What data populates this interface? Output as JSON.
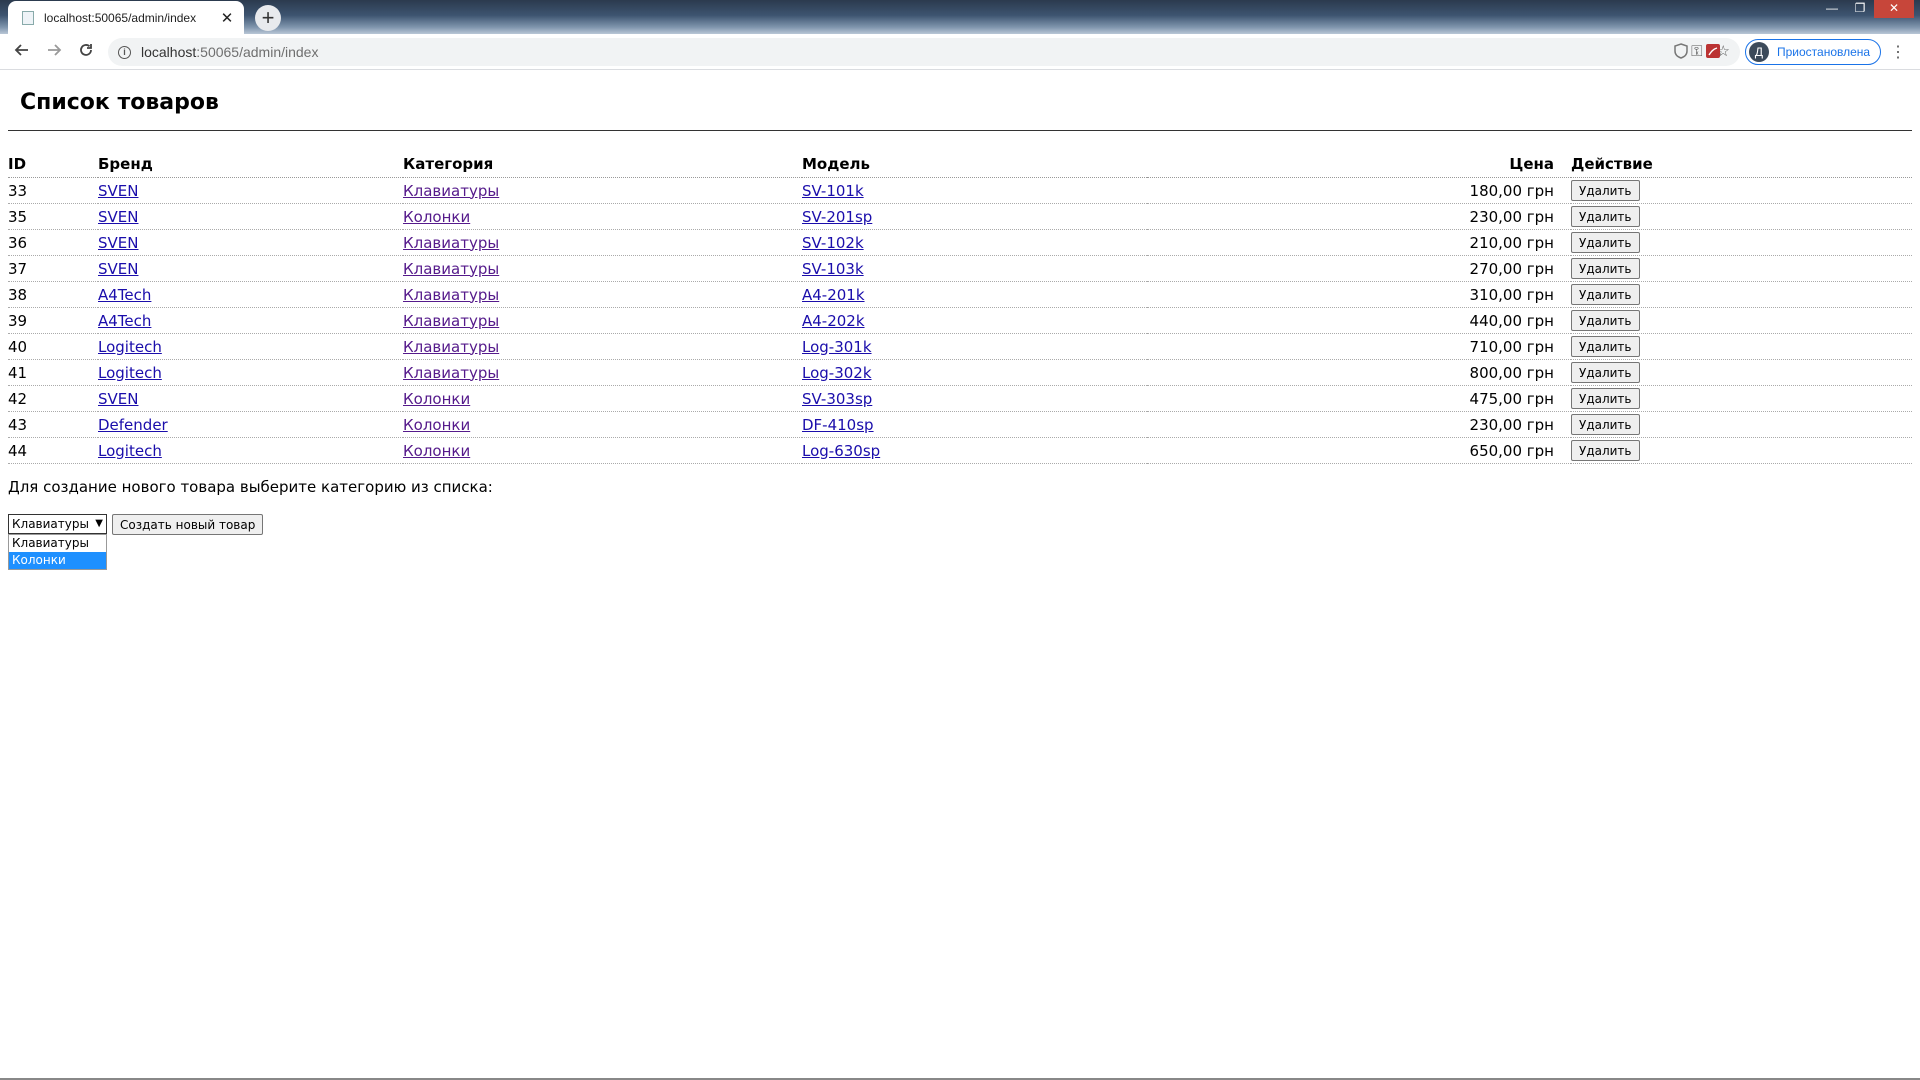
{
  "browser": {
    "tab_title": "localhost:50065/admin/index",
    "tab_close": "✕",
    "new_tab": "+",
    "url_host": "localhost",
    "url_path": ":50065/admin/index",
    "profile_initial": "Д",
    "profile_label": "Приостановлена",
    "window_controls": {
      "minimize": "—",
      "maximize": "❐",
      "close": "✕"
    },
    "icons": [
      "back-icon",
      "forward-icon",
      "reload-icon",
      "info-icon",
      "key-icon",
      "star-icon",
      "shield-icon",
      "pdf-icon",
      "menu-icon"
    ]
  },
  "page": {
    "title": "Список товаров",
    "columns": {
      "id": "ID",
      "brand": "Бренд",
      "category": "Категория",
      "model": "Модель",
      "price": "Цена",
      "action": "Действие"
    },
    "delete_label": "Удалить",
    "rows": [
      {
        "id": "33",
        "brand": "SVEN",
        "category": "Клавиатуры",
        "model": "SV-101k",
        "price": "180,00 грн"
      },
      {
        "id": "35",
        "brand": "SVEN",
        "category": "Колонки",
        "model": "SV-201sp",
        "price": "230,00 грн"
      },
      {
        "id": "36",
        "brand": "SVEN",
        "category": "Клавиатуры",
        "model": "SV-102k",
        "price": "210,00 грн"
      },
      {
        "id": "37",
        "brand": "SVEN",
        "category": "Клавиатуры",
        "model": "SV-103k",
        "price": "270,00 грн"
      },
      {
        "id": "38",
        "brand": "A4Tech",
        "category": "Клавиатуры",
        "model": "A4-201k",
        "price": "310,00 грн"
      },
      {
        "id": "39",
        "brand": "A4Tech",
        "category": "Клавиатуры",
        "model": "A4-202k",
        "price": "440,00 грн"
      },
      {
        "id": "40",
        "brand": "Logitech",
        "category": "Клавиатуры",
        "model": "Log-301k",
        "price": "710,00 грн"
      },
      {
        "id": "41",
        "brand": "Logitech",
        "category": "Клавиатуры",
        "model": "Log-302k",
        "price": "800,00 грн"
      },
      {
        "id": "42",
        "brand": "SVEN",
        "category": "Колонки",
        "model": "SV-303sp",
        "price": "475,00 грн"
      },
      {
        "id": "43",
        "brand": "Defender",
        "category": "Колонки",
        "model": "DF-410sp",
        "price": "230,00 грн"
      },
      {
        "id": "44",
        "brand": "Logitech",
        "category": "Колонки",
        "model": "Log-630sp",
        "price": "650,00 грн"
      }
    ],
    "hint": "Для создание нового товара выберите категорию из списка:",
    "category_select": {
      "value": "Клавиатуры",
      "options": [
        "Клавиатуры",
        "Колонки"
      ],
      "highlighted": "Колонки"
    },
    "create_button": "Создать новый товар"
  },
  "colors": {
    "link": "#1a0dab",
    "visited_link": "#551a8b",
    "highlight": "#1e90ff",
    "profile_accent": "#1a73e8"
  }
}
